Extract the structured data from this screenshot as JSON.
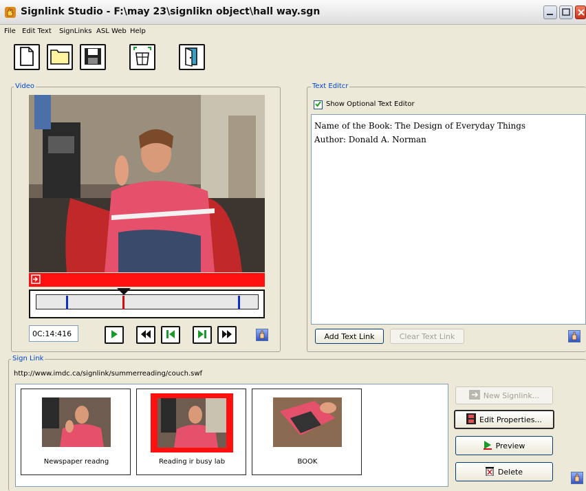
{
  "window": {
    "title": "Signlink Studio - F:\\may 23\\signlikn object\\hall way.sgn"
  },
  "menu": [
    "File",
    "Edit Text",
    "SignLinks",
    "ASL Web",
    "Help"
  ],
  "video_panel": {
    "legend": "Video",
    "timecode": "0C:14:416"
  },
  "text_editor": {
    "legend": "Text Editcr",
    "show_optional_label": "Show Optional Text Editor",
    "show_optional_checked": true,
    "lines": [
      "Name of the Book: The Design of Everyday Things",
      "Author: Donald A. Norman"
    ],
    "add_text_link": "Add Text Link",
    "clear_text_link": "Clear Text Link"
  },
  "sign_link": {
    "legend": "Sign Link",
    "url": "http://www.imdc.ca/signlink/summerreading/couch.swf",
    "thumbnails": [
      {
        "label": "Newspaper readng",
        "selected": false
      },
      {
        "label": "Reading ir busy lab",
        "selected": true
      },
      {
        "label": "BOOK",
        "selected": false
      }
    ],
    "buttons": {
      "new_signlink": "New Signlink...",
      "edit_properties": "Edit Properties...",
      "preview": "Preview",
      "delete": "Delete"
    }
  },
  "colors": {
    "accent_red": "#ff1010",
    "legend_blue": "#0046d5",
    "window_bg": "#ece9d8"
  },
  "icons": {
    "toolbar": [
      "new-file-icon",
      "open-folder-icon",
      "save-disk-icon",
      "capture-icon",
      "exit-door-icon"
    ],
    "playback": [
      "play-icon",
      "rewind-icon",
      "step-back-icon",
      "step-forward-icon",
      "fast-forward-icon"
    ]
  }
}
